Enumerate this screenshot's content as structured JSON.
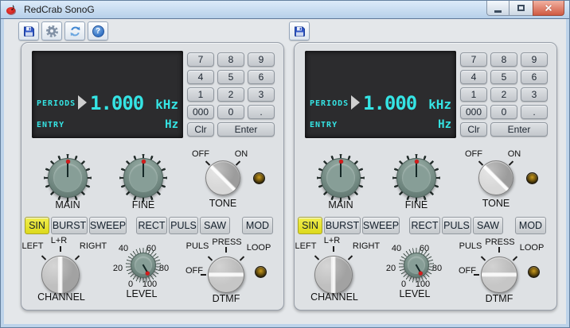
{
  "window": {
    "title": "RedCrab SonoG"
  },
  "toolbar": {
    "left_icons": [
      "save",
      "settings",
      "refresh",
      "help"
    ],
    "right_icons": [
      "save"
    ],
    "help_glyph": "?"
  },
  "colors": {
    "display_text_cyan": "#35e4e4",
    "display_bg": "#2c2c2e",
    "active_wave_yellow": "#e8e636",
    "led_amber": "#8a6a10",
    "knob_teal": "#7d948d",
    "titlebar_blue": "#c4d8ee"
  },
  "panels": [
    {
      "display": {
        "mode": "PERIODS",
        "value": "1.000",
        "unit": "kHz",
        "entry_label": "ENTRY",
        "entry_unit": "Hz"
      },
      "keypad": {
        "keys": [
          "7",
          "8",
          "9",
          "4",
          "5",
          "6",
          "1",
          "2",
          "3",
          "000",
          "0",
          "."
        ],
        "clear_label": "Clr",
        "enter_label": "Enter"
      },
      "main_knob_label": "MAIN",
      "fine_knob_label": "FINE",
      "tone": {
        "label": "TONE",
        "off": "OFF",
        "on": "ON",
        "value": "OFF"
      },
      "waveforms": {
        "buttons": [
          "SIN",
          "BURST",
          "SWEEP",
          "RECT",
          "PULS",
          "SAW",
          "MOD"
        ],
        "active": "SIN"
      },
      "channel": {
        "label": "CHANNEL",
        "options": [
          "LEFT",
          "L+R",
          "RIGHT"
        ],
        "value": "L+R"
      },
      "level": {
        "label": "LEVEL",
        "scale": [
          "0",
          "20",
          "40",
          "60",
          "80",
          "100"
        ],
        "value": "100"
      },
      "dtmf": {
        "label": "DTMF",
        "options": [
          "OFF",
          "PULS",
          "PRESS",
          "LOOP"
        ],
        "value": "OFF"
      }
    },
    {
      "display": {
        "mode": "PERIODS",
        "value": "1.000",
        "unit": "kHz",
        "entry_label": "ENTRY",
        "entry_unit": "Hz"
      },
      "keypad": {
        "keys": [
          "7",
          "8",
          "9",
          "4",
          "5",
          "6",
          "1",
          "2",
          "3",
          "000",
          "0",
          "."
        ],
        "clear_label": "Clr",
        "enter_label": "Enter"
      },
      "main_knob_label": "MAIN",
      "fine_knob_label": "FINE",
      "tone": {
        "label": "TONE",
        "off": "OFF",
        "on": "ON",
        "value": "OFF"
      },
      "waveforms": {
        "buttons": [
          "SIN",
          "BURST",
          "SWEEP",
          "RECT",
          "PULS",
          "SAW",
          "MOD"
        ],
        "active": "SIN"
      },
      "channel": {
        "label": "CHANNEL",
        "options": [
          "LEFT",
          "L+R",
          "RIGHT"
        ],
        "value": "L+R"
      },
      "level": {
        "label": "LEVEL",
        "scale": [
          "0",
          "20",
          "40",
          "60",
          "80",
          "100"
        ],
        "value": "100"
      },
      "dtmf": {
        "label": "DTMF",
        "options": [
          "OFF",
          "PULS",
          "PRESS",
          "LOOP"
        ],
        "value": "OFF"
      }
    }
  ]
}
